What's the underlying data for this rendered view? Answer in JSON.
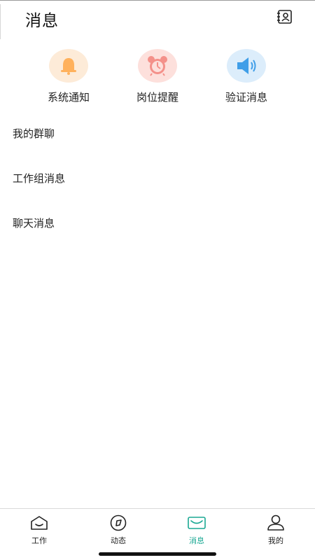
{
  "header": {
    "title": "消息",
    "action_icon": "contacts-book-icon"
  },
  "quick_actions": [
    {
      "label": "系统通知",
      "icon": "bell-icon",
      "color": "#ffb15c",
      "bg": "#fdebd8"
    },
    {
      "label": "岗位提醒",
      "icon": "alarm-clock-icon",
      "color": "#f4918a",
      "bg": "#fde0dc"
    },
    {
      "label": "验证消息",
      "icon": "speaker-icon",
      "color": "#3f9ee8",
      "bg": "#dcedfb"
    }
  ],
  "list": [
    {
      "label": "我的群聊"
    },
    {
      "label": "工作组消息"
    },
    {
      "label": "聊天消息"
    }
  ],
  "tabbar": {
    "active_color": "#1aa893",
    "tabs": [
      {
        "label": "工作",
        "icon": "home-icon",
        "active": false
      },
      {
        "label": "动态",
        "icon": "compass-icon",
        "active": false
      },
      {
        "label": "消息",
        "icon": "mail-icon",
        "active": true
      },
      {
        "label": "我的",
        "icon": "user-icon",
        "active": false
      }
    ]
  }
}
